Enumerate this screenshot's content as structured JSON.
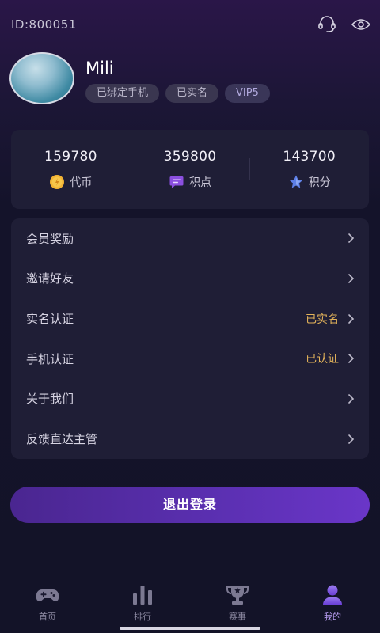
{
  "header": {
    "user_id": "ID:800051",
    "username": "Mili",
    "tags": [
      "已绑定手机",
      "已实名",
      "VIP5"
    ]
  },
  "stats": [
    {
      "value": "159780",
      "label": "代币",
      "icon": "coin-icon"
    },
    {
      "value": "359800",
      "label": "积点",
      "icon": "message-icon"
    },
    {
      "value": "143700",
      "label": "积分",
      "icon": "star-icon"
    }
  ],
  "menu": [
    {
      "label": "会员奖励",
      "value": ""
    },
    {
      "label": "邀请好友",
      "value": ""
    },
    {
      "label": "实名认证",
      "value": "已实名"
    },
    {
      "label": "手机认证",
      "value": "已认证"
    },
    {
      "label": "关于我们",
      "value": ""
    },
    {
      "label": "反馈直达主管",
      "value": ""
    }
  ],
  "logout_label": "退出登录",
  "tabs": [
    {
      "label": "首页",
      "icon": "gamepad-icon",
      "active": false
    },
    {
      "label": "排行",
      "icon": "bar-chart-icon",
      "active": false
    },
    {
      "label": "赛事",
      "icon": "trophy-icon",
      "active": false
    },
    {
      "label": "我的",
      "icon": "user-icon",
      "active": true
    }
  ],
  "colors": {
    "accent": "#6a36c8",
    "status_value": "#e3b35a",
    "active_tab": "#b79cf0"
  }
}
